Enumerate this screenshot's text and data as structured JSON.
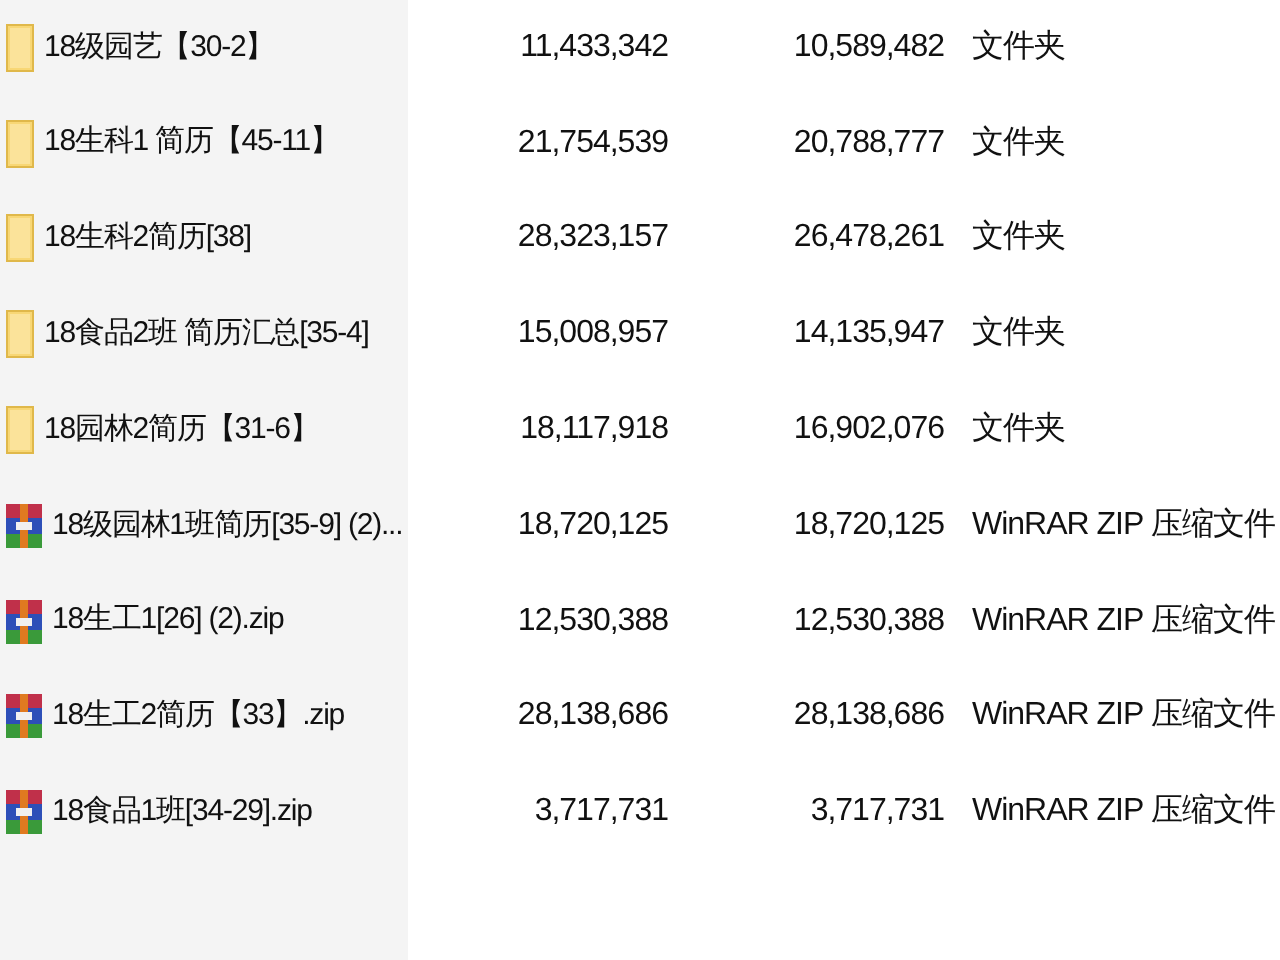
{
  "files": [
    {
      "kind": "folder",
      "name": "18级园艺【30-2】",
      "size": "11,433,342",
      "packed": "10,589,482",
      "type": "文件夹"
    },
    {
      "kind": "folder",
      "name": "18生科1 简历【45-11】",
      "size": "21,754,539",
      "packed": "20,788,777",
      "type": "文件夹"
    },
    {
      "kind": "folder",
      "name": "18生科2简历[38]",
      "size": "28,323,157",
      "packed": "26,478,261",
      "type": "文件夹"
    },
    {
      "kind": "folder",
      "name": "18食品2班 简历汇总[35-4]",
      "size": "15,008,957",
      "packed": "14,135,947",
      "type": "文件夹"
    },
    {
      "kind": "folder",
      "name": "18园林2简历【31-6】",
      "size": "18,117,918",
      "packed": "16,902,076",
      "type": "文件夹"
    },
    {
      "kind": "archive",
      "name": "18级园林1班简历[35-9] (2)...",
      "size": "18,720,125",
      "packed": "18,720,125",
      "type": "WinRAR ZIP 压缩文件"
    },
    {
      "kind": "archive",
      "name": "18生工1[26] (2).zip",
      "size": "12,530,388",
      "packed": "12,530,388",
      "type": "WinRAR ZIP 压缩文件"
    },
    {
      "kind": "archive",
      "name": "18生工2简历【33】.zip",
      "size": "28,138,686",
      "packed": "28,138,686",
      "type": "WinRAR ZIP 压缩文件"
    },
    {
      "kind": "archive",
      "name": "18食品1班[34-29].zip",
      "size": "3,717,731",
      "packed": "3,717,731",
      "type": "WinRAR ZIP 压缩文件"
    }
  ]
}
